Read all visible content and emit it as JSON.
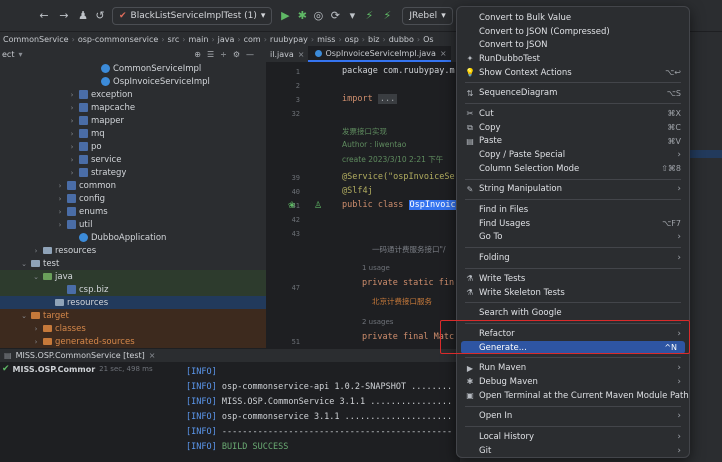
{
  "toolbar": {
    "run_config": "BlackListServiceImplTest (1)",
    "jrebel": "JRebel"
  },
  "breadcrumb": [
    "CommonService",
    "osp-commonservice",
    "src",
    "main",
    "java",
    "com",
    "ruubypay",
    "miss",
    "osp",
    "biz",
    "dubbo",
    "Os"
  ],
  "project_header": "ect",
  "editor_tabs": [
    {
      "label": "il.java",
      "active": false
    },
    {
      "label": "OspInvoiceServiceImpl.java",
      "active": true
    }
  ],
  "tree": [
    {
      "label": "CommonServiceImpl",
      "indent": 100,
      "icon": "class",
      "chev": ""
    },
    {
      "label": "OspInvoiceServiceImpl",
      "indent": 100,
      "icon": "class",
      "chev": ""
    },
    {
      "label": "exception",
      "indent": 78,
      "icon": "package",
      "chev": "›"
    },
    {
      "label": "mapcache",
      "indent": 78,
      "icon": "package",
      "chev": "›"
    },
    {
      "label": "mapper",
      "indent": 78,
      "icon": "package",
      "chev": "›"
    },
    {
      "label": "mq",
      "indent": 78,
      "icon": "package",
      "chev": "›"
    },
    {
      "label": "po",
      "indent": 78,
      "icon": "package",
      "chev": "›"
    },
    {
      "label": "service",
      "indent": 78,
      "icon": "package",
      "chev": "›"
    },
    {
      "label": "strategy",
      "indent": 78,
      "icon": "package",
      "chev": "›"
    },
    {
      "label": "common",
      "indent": 66,
      "icon": "package",
      "chev": "›"
    },
    {
      "label": "config",
      "indent": 66,
      "icon": "package",
      "chev": "›"
    },
    {
      "label": "enums",
      "indent": 66,
      "icon": "package",
      "chev": "›"
    },
    {
      "label": "util",
      "indent": 66,
      "icon": "package",
      "chev": "›"
    },
    {
      "label": "DubboApplication",
      "indent": 78,
      "icon": "class",
      "chev": ""
    },
    {
      "label": "resources",
      "indent": 42,
      "icon": "folder",
      "chev": "›"
    },
    {
      "label": "test",
      "indent": 30,
      "icon": "folder",
      "chev": "⌄"
    },
    {
      "label": "java",
      "indent": 42,
      "icon": "folder-green",
      "chev": "⌄",
      "style": "sel-green"
    },
    {
      "label": "csp.biz",
      "indent": 66,
      "icon": "package",
      "chev": "",
      "style": "sel-green"
    },
    {
      "label": "resources",
      "indent": 54,
      "icon": "folder",
      "chev": "",
      "style": "sel-blue"
    },
    {
      "label": "target",
      "indent": 30,
      "icon": "folder-orange",
      "chev": "⌄",
      "style": "sel-orange"
    },
    {
      "label": "classes",
      "indent": 42,
      "icon": "folder-orange",
      "chev": "›",
      "style": "sel-orange"
    },
    {
      "label": "generated-sources",
      "indent": 42,
      "icon": "folder-orange",
      "chev": "›",
      "style": "sel-orange"
    }
  ],
  "gutter": {
    "lines": [
      "1",
      "2",
      "3",
      "32",
      "39",
      "40",
      "41",
      "42",
      "43",
      "47",
      "51"
    ]
  },
  "editor": {
    "package_line": "package com.ruubypay.m",
    "import_kw": "import",
    "import_fold": "...",
    "doc_title": "发票接口实现",
    "doc_author": "Author : liwentao",
    "doc_create": "create  2023/3/10 2:21 下午",
    "service_ann": "@Service(\"ospInvoiceSe",
    "slf4j_ann": "@Slf4j",
    "public_class": "public class",
    "class_name": "OspInvoic",
    "comment1": "一码通计费服务接口\"/",
    "usage1": "1 usage",
    "private_static": "private static fin",
    "comment2": "北京计费接口服务",
    "usage2": "2 usages",
    "private_final": "private final Matc"
  },
  "run": {
    "header": "MISS.OSP.CommonService [test]",
    "item": "MISS.OSP.Commor",
    "item_time": "21 sec, 498 ms"
  },
  "console": [
    {
      "tag": "[INFO]",
      "text": ""
    },
    {
      "tag": "[INFO]",
      "text": " osp-commonservice-api 1.0.2-SNAPSHOT ........"
    },
    {
      "tag": "[INFO]",
      "text": " MISS.OSP.CommonService 3.1.1 ................"
    },
    {
      "tag": "[INFO]",
      "text": " osp-commonservice 3.1.1 ....................."
    },
    {
      "tag": "[INFO]",
      "text": " ---------------------------------------------"
    },
    {
      "tag": "[INFO]",
      "text": " BUILD SUCCESS",
      "success": true
    }
  ],
  "menu": {
    "items": [
      {
        "label": "Convert to Bulk Value",
        "name": "menu-convert-bulk"
      },
      {
        "label": "Convert to JSON (Compressed)",
        "name": "menu-convert-json-compressed"
      },
      {
        "label": "Convert to JSON",
        "name": "menu-convert-json"
      },
      {
        "label": "RunDubboTest",
        "name": "menu-run-dubbo-test",
        "icon": "dubbo-icon",
        "glyph": "✦"
      },
      {
        "label": "Show Context Actions",
        "name": "menu-show-context-actions",
        "icon": "bulb-icon",
        "glyph": "💡",
        "shortcut": "⌥↩"
      },
      {
        "sep": true
      },
      {
        "label": "SequenceDiagram",
        "name": "menu-sequence-diagram",
        "icon": "diagram-icon",
        "glyph": "⇅",
        "shortcut": "⌥S"
      },
      {
        "sep": true
      },
      {
        "label": "Cut",
        "name": "menu-cut",
        "icon": "scissors-icon",
        "glyph": "✂",
        "shortcut": "⌘X"
      },
      {
        "label": "Copy",
        "name": "menu-copy",
        "icon": "copy-icon",
        "glyph": "⧉",
        "shortcut": "⌘C"
      },
      {
        "label": "Paste",
        "name": "menu-paste",
        "icon": "clipboard-icon",
        "glyph": "▤",
        "shortcut": "⌘V"
      },
      {
        "label": "Copy / Paste Special",
        "name": "menu-copy-paste-special",
        "arrow": true
      },
      {
        "label": "Column Selection Mode",
        "name": "menu-column-selection",
        "shortcut": "⇧⌘8"
      },
      {
        "sep": true
      },
      {
        "label": "String Manipulation",
        "name": "menu-string-manipulation",
        "icon": "pen-icon",
        "glyph": "✎",
        "arrow": true
      },
      {
        "sep": true
      },
      {
        "label": "Find in Files",
        "name": "menu-find-in-files"
      },
      {
        "label": "Find Usages",
        "name": "menu-find-usages",
        "shortcut": "⌥F7"
      },
      {
        "label": "Go To",
        "name": "menu-go-to",
        "arrow": true
      },
      {
        "sep": true
      },
      {
        "label": "Folding",
        "name": "menu-folding",
        "arrow": true
      },
      {
        "sep": true
      },
      {
        "label": "Write Tests",
        "name": "menu-write-tests",
        "icon": "test-icon",
        "glyph": "⚗"
      },
      {
        "label": "Write Skeleton Tests",
        "name": "menu-write-skeleton-tests",
        "icon": "test-icon",
        "glyph": "⚗"
      },
      {
        "sep": true
      },
      {
        "label": "Search with Google",
        "name": "menu-search-google"
      },
      {
        "sep": true
      },
      {
        "label": "Refactor",
        "name": "menu-refactor",
        "arrow": true
      },
      {
        "label": "Generate...",
        "name": "menu-generate",
        "shortcut": "^N",
        "active": true
      },
      {
        "sep": true
      },
      {
        "label": "Run Maven",
        "name": "menu-run-maven",
        "icon": "maven-icon",
        "glyph": "▶",
        "arrow": true
      },
      {
        "label": "Debug Maven",
        "name": "menu-debug-maven",
        "icon": "debug-icon",
        "glyph": "✱",
        "arrow": true
      },
      {
        "label": "Open Terminal at the Current Maven Module Path",
        "name": "menu-open-terminal",
        "icon": "terminal-icon",
        "glyph": "▣"
      },
      {
        "sep": true
      },
      {
        "label": "Open In",
        "name": "menu-open-in",
        "arrow": true
      },
      {
        "sep": true
      },
      {
        "label": "Local History",
        "name": "menu-local-history",
        "arrow": true
      },
      {
        "label": "Git",
        "name": "menu-git",
        "arrow": true
      }
    ]
  },
  "colors": {
    "accent": "#3574f0",
    "selection": "#2e55a3",
    "highlight_box": "#d92b2b"
  }
}
